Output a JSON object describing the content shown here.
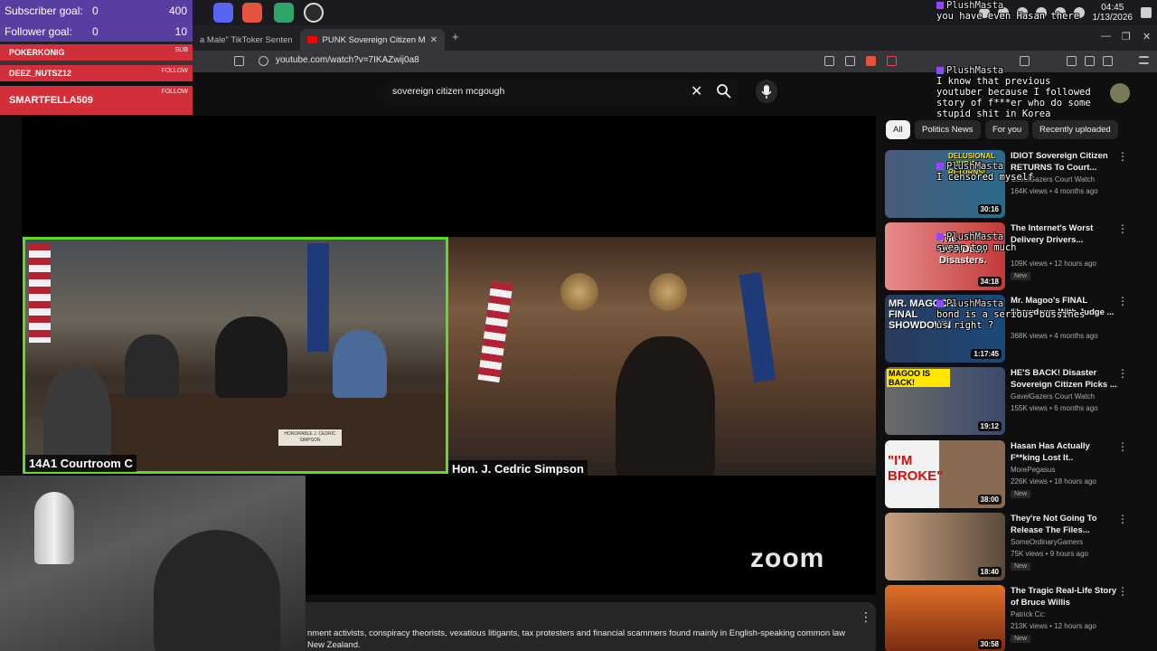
{
  "taskbar": {
    "clock_time": "04:45",
    "clock_date": "1/13/2026"
  },
  "browser": {
    "tabs": [
      {
        "label": "a Male\" TikToker Sentence",
        "active": false
      },
      {
        "label": "PUNK Sovereign Citizen M",
        "active": true
      }
    ],
    "url": "youtube.com/watch?v=7IKAZwij0a8"
  },
  "youtube": {
    "search_query": "sovereign citizen mcgough",
    "chips": [
      "All",
      "Politics News",
      "For you",
      "Recently uploaded"
    ],
    "video": {
      "label_left": "14A1 Courtroom C",
      "label_right": "Hon. J. Cedric Simpson",
      "nameplate": "HONORABLE J. CEDRIC SIMPSON",
      "zoom_logo": "zoom"
    },
    "description": "nment activists, conspiracy theorists, vexatious litigants, tax protesters and financial scammers found mainly in English-speaking common law\nNew Zealand.",
    "recommendations": [
      {
        "title": "IDIOT Sovereign Citizen RETURNS To Court... ",
        "channel": "GavelGazers Court Watch",
        "meta": "164K views • 4 months ago",
        "duration": "30:16",
        "new": "",
        "thumb_text": "DELUSIONAL SOVCIT RETURNS!"
      },
      {
        "title": "The Internet's Worst Delivery Drivers...",
        "channel": "",
        "meta": "109K views • 12 hours ago",
        "duration": "34:18",
        "new": "New",
        "thumb_text": "The DoorDash Disasters."
      },
      {
        "title": "Mr. Magoo's FINAL Showdown With Judge ...",
        "channel": "",
        "meta": "368K views • 4 months ago",
        "duration": "1:17:45",
        "new": "",
        "thumb_text": "MR. MAGOO'S FINAL SHOWDOWN"
      },
      {
        "title": "HE'S BACK! Disaster Sovereign Citizen Picks ...",
        "channel": "GavelGazers Court Watch",
        "meta": "155K views • 6 months ago",
        "duration": "19:12",
        "new": "",
        "thumb_text": "MAGOO IS BACK!"
      },
      {
        "title": "Hasan Has Actually F**king Lost It..",
        "channel": "MorePegasus",
        "meta": "226K views • 18 hours ago",
        "duration": "38:00",
        "new": "New",
        "thumb_text": "\"I'M BROKE\""
      },
      {
        "title": "They're Not Going To Release The Files...",
        "channel": "SomeOrdinaryGamers",
        "meta": "75K views • 9 hours ago",
        "duration": "18:40",
        "new": "New",
        "thumb_text": ""
      },
      {
        "title": "The Tragic Real-Life Story of Bruce Willis",
        "channel": "Patrick Cc:",
        "meta": "213K views • 12 hours ago",
        "duration": "30:58",
        "new": "New",
        "thumb_text": ""
      }
    ]
  },
  "overlay": {
    "subscriber_goal_label": "Subscriber goal:",
    "subscriber_goal_current": "0",
    "subscriber_goal_target": "400",
    "follower_goal_label": "Follower goal:",
    "follower_goal_current": "0",
    "follower_goal_target": "10",
    "alerts": [
      {
        "name": "POKERKONIG",
        "type": "SUB"
      },
      {
        "name": "DEEZ_NUTSZ12",
        "type": "FOLLOW"
      },
      {
        "name": "SMARTFELLA509",
        "type": "FOLLOW"
      }
    ],
    "chat": [
      {
        "name": "PlushMasta",
        "text": "you have even Hasan there"
      },
      {
        "name": "PlushMasta",
        "text": "I know that previous\nyoutuber because I followed\nstory of f***er who do some\nstupid shit in Korea"
      },
      {
        "name": "PlushMasta",
        "text": "I censored myself"
      },
      {
        "name": "PlushMasta",
        "text": "swear too much"
      },
      {
        "name": "PlushMasta",
        "text": "bond is a serious bussines\nus right ?"
      }
    ]
  },
  "colors": {
    "youtube_red": "#ff0000",
    "goal_purple": "#5a3da0",
    "alert_red": "#d32f3a",
    "speaker_border": "#62d82b"
  }
}
